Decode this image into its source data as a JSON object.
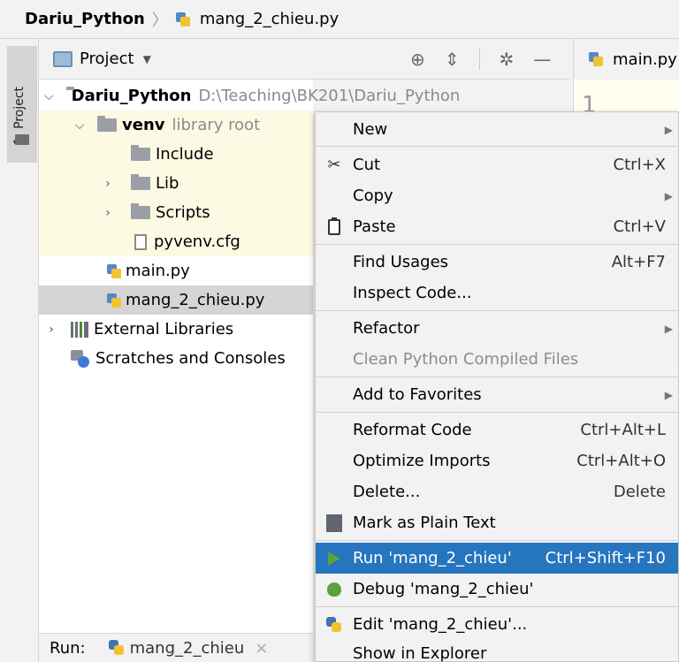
{
  "breadcrumb": {
    "project": "Dariu_Python",
    "file": "mang_2_chieu.py"
  },
  "toolstrip": {
    "project_tab": "1: Project"
  },
  "project_panel": {
    "title": "Project",
    "tools": [
      "crosshair-icon",
      "collapse-icon",
      "gear-icon",
      "minimize-icon"
    ]
  },
  "editor": {
    "tab": "main.py",
    "line_number": "1"
  },
  "tree": {
    "root_name": "Dariu_Python",
    "root_path": "D:\\Teaching\\BK201\\Dariu_Python",
    "venv_name": "venv",
    "venv_hint": "library root",
    "include": "Include",
    "lib": "Lib",
    "scripts": "Scripts",
    "pyvenv": "pyvenv.cfg",
    "main": "main.py",
    "mang": "mang_2_chieu.py",
    "external": "External Libraries",
    "scratches": "Scratches and Consoles"
  },
  "run_bar": {
    "label": "Run:",
    "tab": "mang_2_chieu",
    "close": "×"
  },
  "menu": {
    "new": "New",
    "cut": "Cut",
    "cut_key": "Ctrl+X",
    "copy": "Copy",
    "paste": "Paste",
    "paste_key": "Ctrl+V",
    "find_usages": "Find Usages",
    "find_key": "Alt+F7",
    "inspect": "Inspect Code...",
    "refactor": "Refactor",
    "clean": "Clean Python Compiled Files",
    "favorites": "Add to Favorites",
    "reformat": "Reformat Code",
    "reformat_key": "Ctrl+Alt+L",
    "optimize": "Optimize Imports",
    "optimize_key": "Ctrl+Alt+O",
    "delete": "Delete...",
    "delete_key": "Delete",
    "plain": "Mark as Plain Text",
    "run": "Run 'mang_2_chieu'",
    "run_key": "Ctrl+Shift+F10",
    "debug": "Debug 'mang_2_chieu'",
    "edit": "Edit 'mang_2_chieu'...",
    "explorer": "Show in Explorer"
  },
  "colors": {
    "selection": "#2675bf",
    "venv_bg": "#fdfae3",
    "run_green": "#5aa33c"
  }
}
